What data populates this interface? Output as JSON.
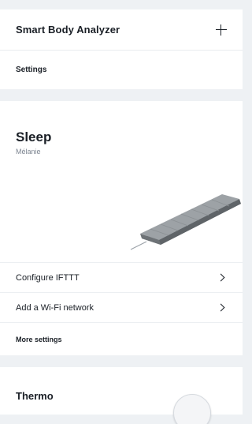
{
  "devices": {
    "smart_body_analyzer": {
      "name": "Smart Body Analyzer",
      "add_icon": "plus-icon",
      "settings_label": "Settings"
    },
    "sleep": {
      "name": "Sleep",
      "owner": "Mélanie",
      "image": "sleep-mat-image",
      "rows": [
        {
          "label": "Configure IFTTT",
          "icon": "chevron-right-icon"
        },
        {
          "label": "Add a Wi-Fi network",
          "icon": "chevron-right-icon"
        }
      ],
      "more_settings_label": "More settings"
    },
    "thermo": {
      "name": "Thermo",
      "image": "thermo-device-image"
    }
  },
  "colors": {
    "background": "#eef1f4",
    "card": "#ffffff",
    "text": "#1a1f26",
    "muted_text": "#7c8490"
  }
}
